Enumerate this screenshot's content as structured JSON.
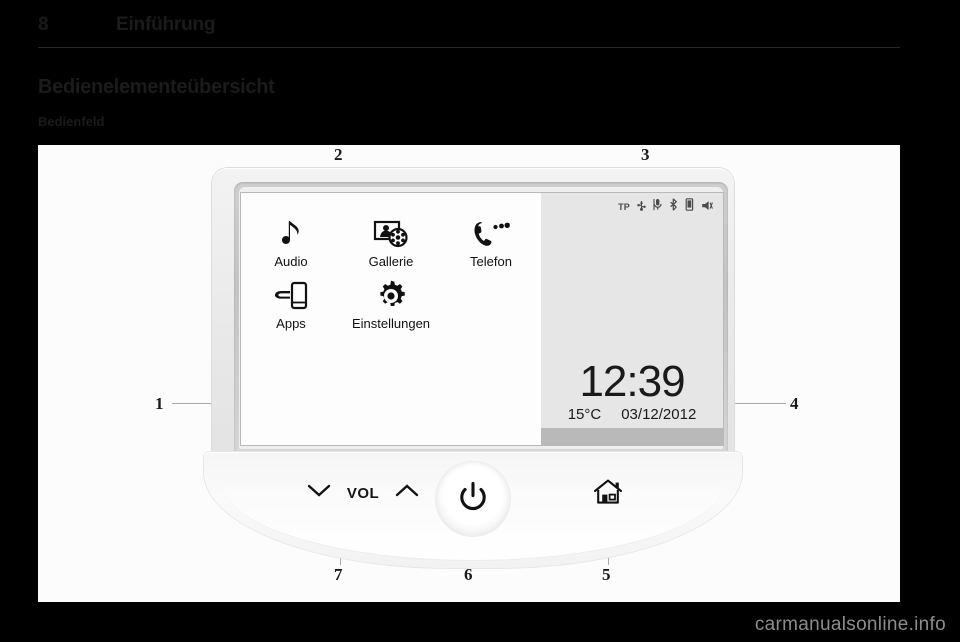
{
  "header": {
    "page_number": "8",
    "chapter_title": "Einführung"
  },
  "headings": {
    "h1": "Bedienelementeübersicht",
    "h2": "Bedienfeld"
  },
  "figure": {
    "callouts": [
      {
        "label": "1",
        "target": "display-screen"
      },
      {
        "label": "2",
        "target": "home-menu-area"
      },
      {
        "label": "3",
        "target": "status-bar"
      },
      {
        "label": "4",
        "target": "clock-info-area"
      },
      {
        "label": "5",
        "target": "home-button"
      },
      {
        "label": "6",
        "target": "power-button"
      },
      {
        "label": "7",
        "target": "volume-control"
      }
    ],
    "device": {
      "screen": {
        "menu_items": [
          {
            "label": "Audio",
            "icon": "music-note-icon"
          },
          {
            "label": "Gallerie",
            "icon": "gallery-photo-film-icon"
          },
          {
            "label": "Telefon",
            "icon": "phone-handset-icon"
          },
          {
            "label": "Apps",
            "icon": "hand-smartphone-icon"
          },
          {
            "label": "Einstellungen",
            "icon": "gear-icon"
          }
        ],
        "status_icons": [
          {
            "label": "TP",
            "icon": "tp-text-icon"
          },
          {
            "label": "USB",
            "icon": "usb-icon"
          },
          {
            "label": "Microphone",
            "icon": "microphone-icon"
          },
          {
            "label": "Bluetooth",
            "icon": "bluetooth-icon"
          },
          {
            "label": "Phone signal",
            "icon": "mobile-phone-icon"
          },
          {
            "label": "Mute",
            "icon": "speaker-mute-icon"
          }
        ],
        "clock": {
          "time": "12:39",
          "temperature": "15°C",
          "date": "03/12/2012"
        }
      },
      "controls": {
        "volume_label": "VOL",
        "volume_down_icon": "chevron-down-icon",
        "volume_up_icon": "chevron-up-icon",
        "power_icon": "power-icon",
        "home_icon": "home-icon"
      }
    }
  },
  "watermark": "carmanualsonline.info"
}
